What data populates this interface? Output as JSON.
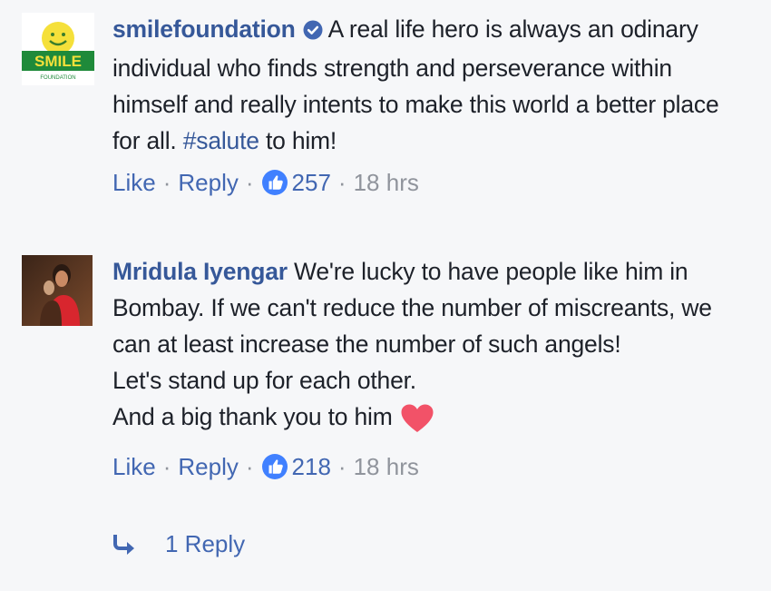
{
  "comments": [
    {
      "author": "smilefoundation",
      "verified": true,
      "avatar": {
        "type": "logo",
        "text": "SMILE",
        "subtext": "FOUNDATION"
      },
      "text_before_hashtag": "A real life hero is always an odinary individual who finds strength and perseverance within himself and really intents to make this world a better place for all. ",
      "hashtag": "#salute",
      "text_after_hashtag": " to him!",
      "actions": {
        "like": "Like",
        "reply": "Reply",
        "reaction_count": "257",
        "time": "18 hrs"
      }
    },
    {
      "author": "Mridula Iyengar",
      "verified": false,
      "avatar": {
        "type": "photo"
      },
      "text_main": "We're lucky to have people like him in Bombay. If we can't reduce the number of miscreants, we can at least increase the number of such angels!",
      "text_line2": "Let's stand up for each other.",
      "text_line3": "And a big thank you to him",
      "emoji": "heart",
      "actions": {
        "like": "Like",
        "reply": "Reply",
        "reaction_count": "218",
        "time": "18 hrs"
      }
    }
  ],
  "replies_link": "1 Reply",
  "colors": {
    "link_blue": "#365899",
    "action_blue": "#4267b2",
    "meta_gray": "#90949c",
    "text": "#1d2129",
    "background": "#f6f7f9",
    "heart": "#f25268",
    "like_badge": "#4080ff"
  },
  "separator": "·"
}
